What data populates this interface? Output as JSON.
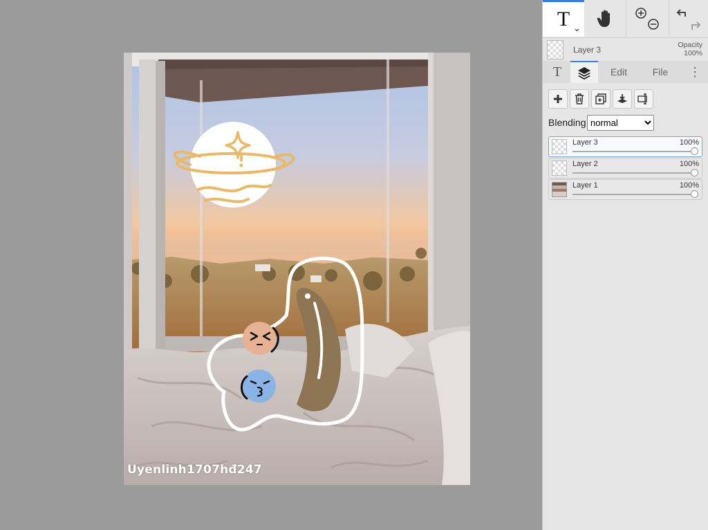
{
  "toolbar": {
    "text_tool_label": "T",
    "text_tool_icon": "text-tool-icon",
    "hand_tool_icon": "hand-icon",
    "zoom_in_icon": "zoom-in-icon",
    "zoom_out_icon": "zoom-out-icon",
    "undo_icon": "undo-icon",
    "redo_icon": "redo-icon"
  },
  "current_layer": {
    "name": "Layer 3",
    "opacity_label": "Opacity",
    "opacity_value": "100%"
  },
  "tabs": {
    "text_label": "T",
    "layers_icon": "layers-icon",
    "edit_label": "Edit",
    "file_label": "File",
    "more_label": "⋮"
  },
  "layer_actions": [
    "add-layer-icon",
    "delete-layer-icon",
    "duplicate-layer-icon",
    "merge-down-icon",
    "layer-properties-icon"
  ],
  "blending": {
    "label": "Blending",
    "selected": "normal"
  },
  "layers": [
    {
      "name": "Layer 3",
      "opacity": "100%",
      "opacity_fraction": 1.0,
      "selected": true
    },
    {
      "name": "Layer 2",
      "opacity": "100%",
      "opacity_fraction": 1.0,
      "selected": false
    },
    {
      "name": "Layer 1",
      "opacity": "100%",
      "opacity_fraction": 1.0,
      "selected": false
    }
  ],
  "canvas": {
    "watermark": "Uyenlinh1707hđ247"
  },
  "colors": {
    "accent": "#3a7bd5",
    "workspace_bg": "#9b9b9b",
    "panel_bg": "#e6e6e6",
    "sticker_gold": "#e8b96a",
    "sticker_brown": "#8d7554",
    "face_peach": "#e7b294",
    "face_blue": "#8ab3e6"
  }
}
